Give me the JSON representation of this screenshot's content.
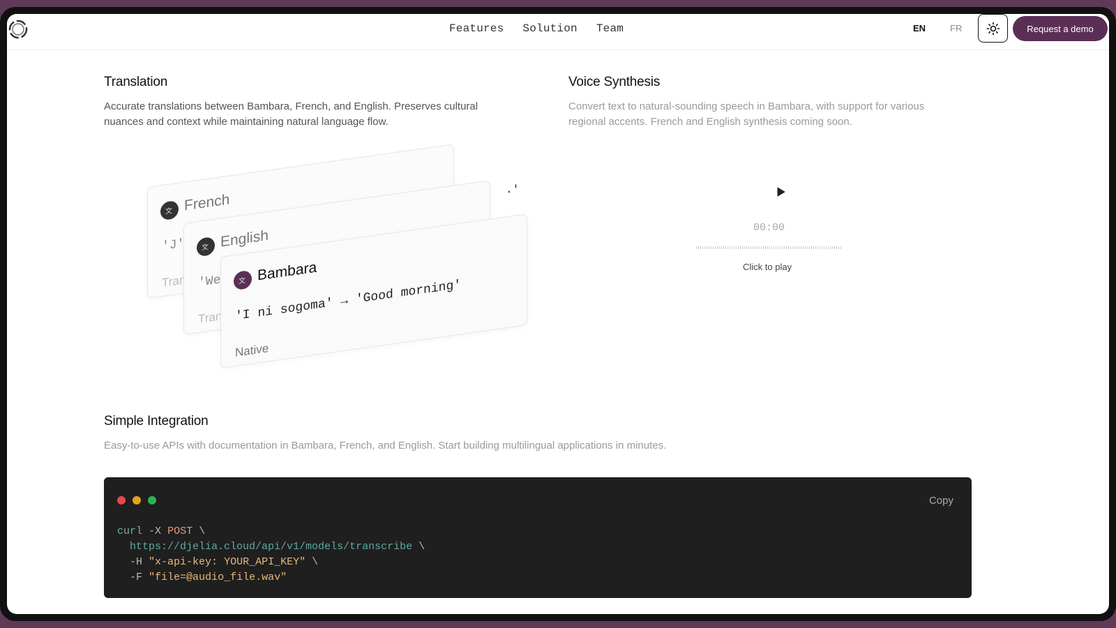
{
  "nav": {
    "links": [
      "Features",
      "Solution",
      "Team"
    ],
    "lang_en": "EN",
    "lang_fr": "FR",
    "demo_label": "Request a demo",
    "theme_icon": "sun-icon"
  },
  "translation": {
    "title": "Translation",
    "desc1": "Accurate translations between Bambara, French, and English. Preserves cultural",
    "desc2": "nuances and context while maintaining natural language flow.",
    "cards": [
      {
        "label": "French",
        "text": "'J'",
        "tag": "Tran"
      },
      {
        "label": "English",
        "text": "'We",
        "tag": "Tran"
      },
      {
        "label": "Bambara",
        "text": "'I ni sogoma' → 'Good morning'",
        "tag": "Native"
      }
    ],
    "stray": ".'"
  },
  "voice": {
    "title": "Voice Synthesis",
    "desc1": "Convert text to natural-sounding speech in Bambara, with support for various",
    "desc2": "regional accents. French and English synthesis coming soon.",
    "time": "00:00",
    "hint": "Click to play"
  },
  "integration": {
    "title": "Simple Integration",
    "desc": "Easy-to-use APIs with documentation in Bambara, French, and English. Start building multilingual applications in minutes.",
    "copy_label": "Copy",
    "code": {
      "cmd": "curl",
      "flag_x": "-X",
      "method": "POST",
      "url": "https://djelia.cloud/api/v1/models/transcribe",
      "flag_h": "-H",
      "header": "\"x-api-key: YOUR_API_KEY\"",
      "flag_f": "-F",
      "file": "\"file=@audio_file.wav\"",
      "cont": "\\"
    }
  },
  "colors": {
    "brand": "#5b2f55",
    "dot_red": "#e5484d",
    "dot_yellow": "#e0a61c",
    "dot_green": "#2ab552"
  }
}
